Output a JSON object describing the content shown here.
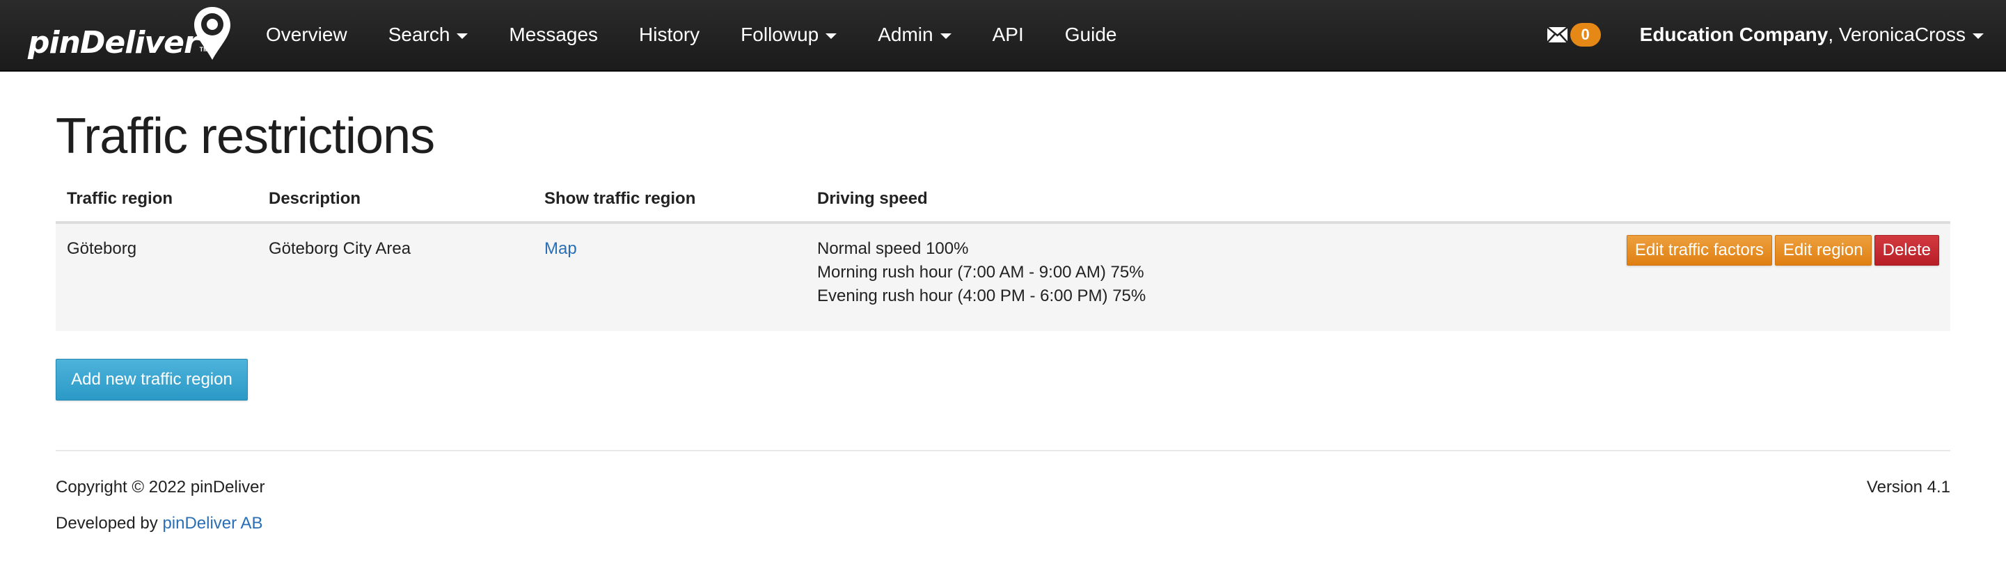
{
  "app": {
    "brand": "pinDeliver",
    "brand_tm": "TM"
  },
  "nav": {
    "items": [
      {
        "label": "Overview",
        "dropdown": false
      },
      {
        "label": "Search",
        "dropdown": true
      },
      {
        "label": "Messages",
        "dropdown": false
      },
      {
        "label": "History",
        "dropdown": false
      },
      {
        "label": "Followup",
        "dropdown": true
      },
      {
        "label": "Admin",
        "dropdown": true
      },
      {
        "label": "API",
        "dropdown": false
      },
      {
        "label": "Guide",
        "dropdown": false
      }
    ],
    "messages_icon": "envelope-icon",
    "message_count": "0",
    "company": "Education Company",
    "separator": ", ",
    "user": "VeronicaCross"
  },
  "page": {
    "title": "Traffic restrictions"
  },
  "table": {
    "headers": [
      "Traffic region",
      "Description",
      "Show traffic region",
      "Driving speed"
    ],
    "rows": [
      {
        "region": "Göteborg",
        "description": "Göteborg City Area",
        "map_link": "Map",
        "speeds": [
          "Normal speed 100%",
          "Morning rush hour (7:00 AM - 9:00 AM) 75%",
          "Evening rush hour (4:00 PM - 6:00 PM) 75%"
        ],
        "actions": {
          "edit_factors": "Edit traffic factors",
          "edit_region": "Edit region",
          "delete": "Delete"
        }
      }
    ]
  },
  "add_button": "Add new traffic region",
  "footer": {
    "copyright": "Copyright © 2022 pinDeliver",
    "developed_by": "Developed by ",
    "developer_link": "pinDeliver AB",
    "version": "Version 4.1"
  },
  "colors": {
    "navbar": "#222222",
    "warning": "#e58816",
    "danger": "#c12a30",
    "info": "#3aa6d0",
    "link": "#2a6fb5"
  }
}
